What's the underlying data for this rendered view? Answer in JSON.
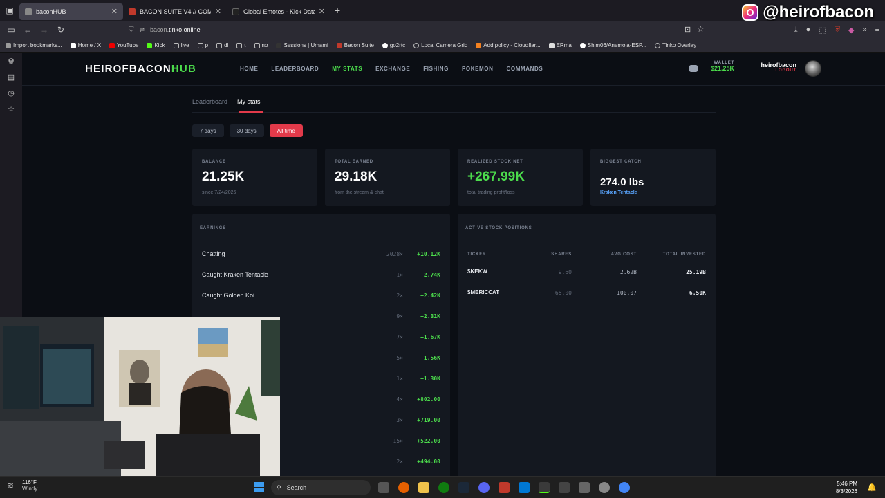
{
  "overlay": {
    "handle": "@heirofbacon"
  },
  "browser": {
    "tabs": [
      {
        "title": "baconHUB",
        "active": true
      },
      {
        "title": "BACON SUITE V4 // COMMAND",
        "active": false
      },
      {
        "title": "Global Emotes - Kick Database",
        "active": false
      }
    ],
    "new_tab": "+",
    "url_host": "bacon.",
    "url_rest": "tinko.online",
    "bookmarks": [
      "Import bookmarks...",
      "Home / X",
      "YouTube",
      "Kick",
      "live",
      "p",
      "dl",
      "t",
      "no",
      "Sessions | Umami",
      "Bacon Suite",
      "go2rtc",
      "Local Camera Grid",
      "Add policy - Cloudflar...",
      "ERma",
      "Shim06/Anemoia-ESP...",
      "Tinko Overlay"
    ]
  },
  "site": {
    "logo_main": "HEIROFBACON",
    "logo_accent": "HUB",
    "nav": [
      "HOME",
      "LEADERBOARD",
      "MY STATS",
      "EXCHANGE",
      "FISHING",
      "POKEMON",
      "COMMANDS"
    ],
    "wallet_label": "WALLET",
    "wallet_value": "$21.25K",
    "username": "heirofbacon",
    "logout": "LOGOUT",
    "subtabs": [
      "Leaderboard",
      "My stats"
    ],
    "ranges": [
      "7 days",
      "30 days",
      "All time"
    ]
  },
  "cards": [
    {
      "label": "BALANCE",
      "value": "21.25K",
      "sub": "since 7/24/2026"
    },
    {
      "label": "TOTAL EARNED",
      "value": "29.18K",
      "sub": "from the stream & chat"
    },
    {
      "label": "REALIZED STOCK NET",
      "value": "+267.99K",
      "sub": "total trading profit/loss"
    },
    {
      "label": "BIGGEST CATCH",
      "value": "274.0 lbs",
      "sub": "Kraken Tentacle"
    }
  ],
  "earnings": {
    "title": "EARNINGS",
    "rows": [
      {
        "name": "Chatting",
        "count": "2028×",
        "amount": "+10.12K"
      },
      {
        "name": "Caught Kraken Tentacle",
        "count": "1×",
        "amount": "+2.74K"
      },
      {
        "name": "Caught Golden Koi",
        "count": "2×",
        "amount": "+2.42K"
      },
      {
        "name": "",
        "count": "9×",
        "amount": "+2.31K"
      },
      {
        "name": "",
        "count": "7×",
        "amount": "+1.67K"
      },
      {
        "name": "",
        "count": "5×",
        "amount": "+1.56K"
      },
      {
        "name": "",
        "count": "1×",
        "amount": "+1.30K"
      },
      {
        "name": "",
        "count": "4×",
        "amount": "+802.00"
      },
      {
        "name": "",
        "count": "3×",
        "amount": "+719.00"
      },
      {
        "name": "",
        "count": "15×",
        "amount": "+522.00"
      },
      {
        "name": "",
        "count": "2×",
        "amount": "+494.00"
      }
    ]
  },
  "stocks": {
    "title": "ACTIVE STOCK POSITIONS",
    "headers": [
      "TICKER",
      "SHARES",
      "AVG COST",
      "TOTAL INVESTED"
    ],
    "rows": [
      {
        "ticker": "$KEKW",
        "shares": "9.60",
        "avg": "2.62B",
        "total": "25.19B"
      },
      {
        "ticker": "$MERICCAT",
        "shares": "65.00",
        "avg": "100.07",
        "total": "6.50K"
      }
    ]
  },
  "taskbar": {
    "temp": "116°F",
    "weather": "Windy",
    "search": "Search",
    "time": "5:46 PM",
    "date": "8/3/2026"
  }
}
